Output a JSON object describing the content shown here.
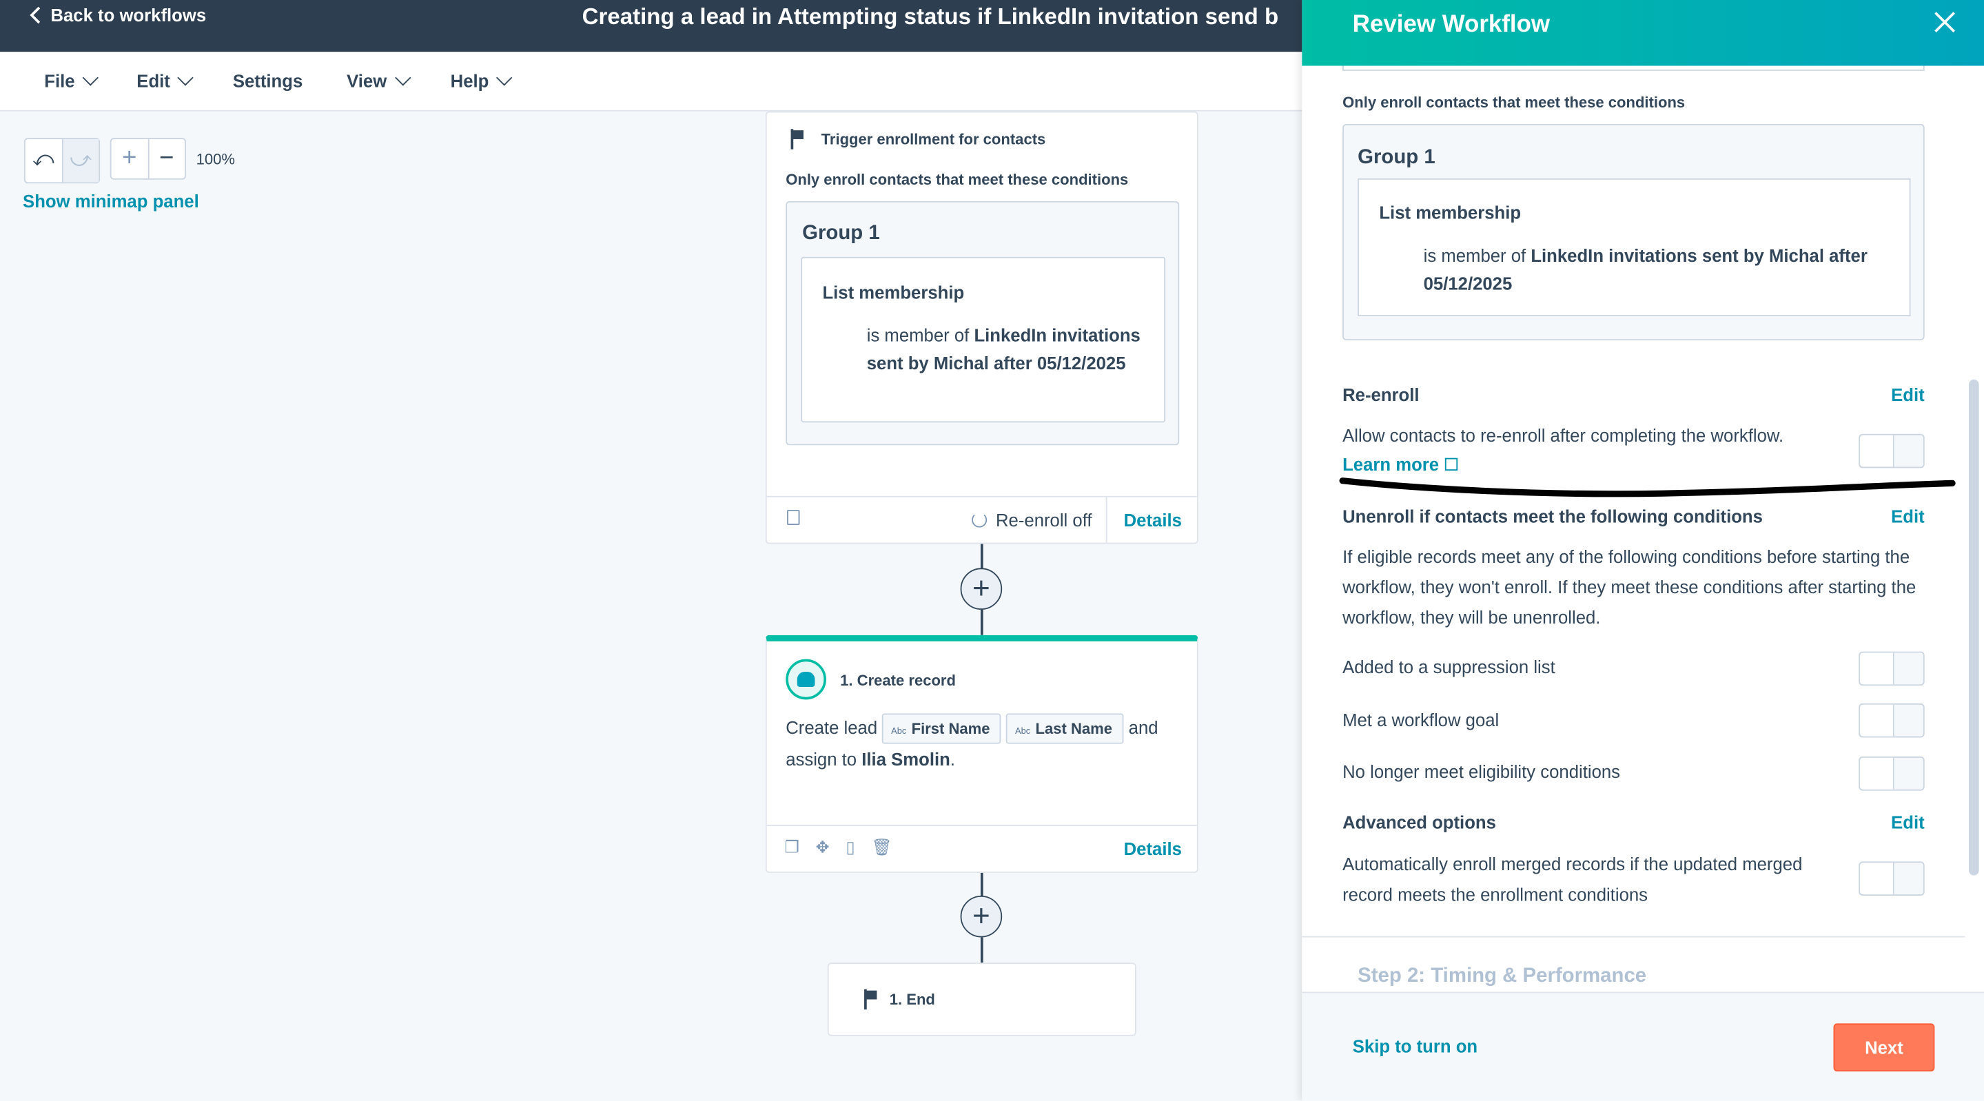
{
  "topbar": {
    "back_label": "Back to workflows",
    "title": "Creating a lead in Attempting status if LinkedIn invitation send b"
  },
  "menu": [
    "File",
    "Edit",
    "Settings",
    "View",
    "Help"
  ],
  "canvas": {
    "zoom": "100%",
    "minimap_link": "Show minimap panel"
  },
  "trigger": {
    "title": "Trigger enrollment for contacts",
    "conditions_label": "Only enroll contacts that meet these conditions",
    "group_title": "Group 1",
    "filter_title": "List membership",
    "filter_prefix": "is member of ",
    "filter_value": "LinkedIn invitations sent by Michal after 05/12/2025",
    "reenroll_status": "Re-enroll off",
    "details": "Details"
  },
  "record": {
    "title": "1. Create record",
    "text_prefix": "Create lead",
    "token1": "First Name",
    "token2": "Last Name",
    "token_type": "Abc",
    "text_mid": "and",
    "text_assign": "assign to",
    "assignee": "Ilia Smolin",
    "text_end": ".",
    "details": "Details"
  },
  "end": {
    "label": "1. End"
  },
  "panel": {
    "title": "Review Workflow",
    "conditions_label": "Only enroll contacts that meet these conditions",
    "group_title": "Group 1",
    "filter_title": "List membership",
    "filter_prefix": "is member of ",
    "filter_value": "LinkedIn invitations sent by Michal after 05/12/2025",
    "reenroll": {
      "title": "Re-enroll",
      "edit": "Edit",
      "text": "Allow contacts to re-enroll after completing the workflow.",
      "learn_more": "Learn more"
    },
    "unenroll": {
      "title": "Unenroll if contacts meet the following conditions",
      "edit": "Edit",
      "text": "If eligible records meet any of the following conditions before starting the workflow, they won't enroll. If they meet these conditions after starting the workflow, they will be unenrolled.",
      "options": [
        "Added to a suppression list",
        "Met a workflow goal",
        "No longer meet eligibility conditions"
      ]
    },
    "advanced": {
      "title": "Advanced options",
      "edit": "Edit",
      "text": "Automatically enroll merged records if the updated merged record meets the enrollment conditions"
    },
    "step2": "Step 2: Timing & Performance",
    "skip": "Skip to turn on",
    "next": "Next"
  },
  "colors": {
    "topbar": "#2d3e50",
    "accent": "#00bda5",
    "link": "#0091ae",
    "primary_button": "#ff7a59"
  }
}
